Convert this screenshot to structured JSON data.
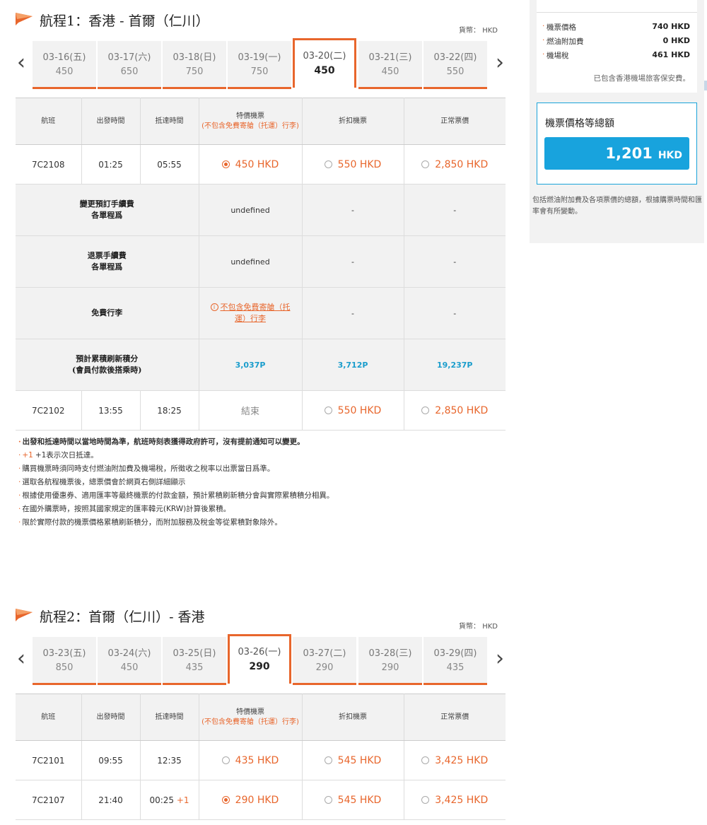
{
  "journey1": {
    "title": "航程1：香港 - 首爾（仁川）",
    "currency": "貨幣： HKD",
    "dates": [
      {
        "date": "03-16(五)",
        "price": "450",
        "active": false
      },
      {
        "date": "03-17(六)",
        "price": "650",
        "active": false
      },
      {
        "date": "03-18(日)",
        "price": "750",
        "active": false
      },
      {
        "date": "03-19(一)",
        "price": "750",
        "active": false
      },
      {
        "date": "03-20(二)",
        "price": "450",
        "active": true
      },
      {
        "date": "03-21(三)",
        "price": "450",
        "active": false
      },
      {
        "date": "03-22(四)",
        "price": "550",
        "active": false
      }
    ],
    "headers": {
      "flight": "航班",
      "depart": "出發時間",
      "arrive": "抵達時間",
      "special_title": "特價機票",
      "special_note": "(不包含免費寄艙（托運）行李)",
      "discount": "折扣機票",
      "regular": "正常票價"
    },
    "flights": [
      {
        "no": "7C2108",
        "dep": "01:25",
        "arr": "05:55",
        "special": "450 HKD",
        "discount": "550 HKD",
        "regular": "2,850 HKD"
      },
      {
        "no": "7C2102",
        "dep": "13:55",
        "arr": "18:25",
        "special": "結束",
        "discount": "550 HKD",
        "regular": "2,850 HKD"
      }
    ],
    "info": {
      "change_fee_l1": "變更預訂手續費",
      "change_fee_l2": "各單程爲",
      "change_fee_val": "undefined",
      "refund_fee_l1": "退票手續費",
      "refund_fee_l2": "各單程爲",
      "refund_fee_val": "undefined",
      "baggage_label": "免費行李",
      "baggage_link_icon": "i",
      "baggage_link_l1": "不包含免費寄艙（托",
      "baggage_link_l2": "運）行李",
      "miles_l1": "預計累積刷新積分",
      "miles_l2": "(會員付款後搭乘時)",
      "miles_special": "3,037P",
      "miles_discount": "3,712P",
      "miles_regular": "19,237P",
      "dash": "-"
    }
  },
  "notes": {
    "n1": "出發和抵達時間以當地時間為準，航班時刻表獲得政府許可，沒有提前通知可以變更。",
    "n2_plus": "+1",
    "n2": "+1表示次日抵達。",
    "n3": "購買機票時須同時支付燃油附加費及機場稅，所徵收之稅率以出票當日爲準。",
    "n4": "選取各航程機票後，總票價會於網頁右側詳細顯示",
    "n5": "根據使用優惠券、適用匯率等最終機票的付款金額，預計累積刷新積分會與實際累積積分相異。",
    "n6": "在國外購票時，按照其國家規定的匯率韓元(KRW)計算後累積。",
    "n7": "限於實際付款的機票價格累積刷新積分，而附加服務及稅金等從累積對象除外。"
  },
  "journey2": {
    "title": "航程2：首爾（仁川）- 香港",
    "currency": "貨幣： HKD",
    "dates": [
      {
        "date": "03-23(五)",
        "price": "850",
        "active": false
      },
      {
        "date": "03-24(六)",
        "price": "450",
        "active": false
      },
      {
        "date": "03-25(日)",
        "price": "435",
        "active": false
      },
      {
        "date": "03-26(一)",
        "price": "290",
        "active": true
      },
      {
        "date": "03-27(二)",
        "price": "290",
        "active": false
      },
      {
        "date": "03-28(三)",
        "price": "290",
        "active": false
      },
      {
        "date": "03-29(四)",
        "price": "435",
        "active": false
      }
    ],
    "headers": {
      "flight": "航班",
      "depart": "出發時間",
      "arrive": "抵達時間",
      "special_title": "特價機票",
      "special_note": "(不包含免費寄艙（托運）行李)",
      "discount": "折扣機票",
      "regular": "正常票價"
    },
    "flights": [
      {
        "no": "7C2101",
        "dep": "09:55",
        "arr": "12:35",
        "arr_plus": "",
        "special": "435 HKD",
        "discount": "545 HKD",
        "regular": "3,425 HKD"
      },
      {
        "no": "7C2107",
        "dep": "21:40",
        "arr": "00:25",
        "arr_plus": "+1",
        "special": "290 HKD",
        "discount": "545 HKD",
        "regular": "3,425 HKD"
      }
    ]
  },
  "sidebar": {
    "ticket_label": "機票價格",
    "ticket_value": "740 HKD",
    "fuel_label": "燃油附加費",
    "fuel_value": "0 HKD",
    "tax_label": "機場稅",
    "tax_value": "461 HKD",
    "included_note": "已包含香港機場旅客保安費。",
    "total_label": "機票價格等總額",
    "total_amount": "1,201",
    "total_currency": "HKD",
    "note": "包括燃油附加費及各項票價的總額，根據購票時間和匯率會有所變動。"
  },
  "icons": {
    "flag": "orange-flag-icon",
    "prev": "chevron-left-icon",
    "next": "chevron-right-icon"
  },
  "colors": {
    "accent": "#e8662c",
    "blue": "#18a3dd",
    "miles": "#1a9dcc"
  }
}
